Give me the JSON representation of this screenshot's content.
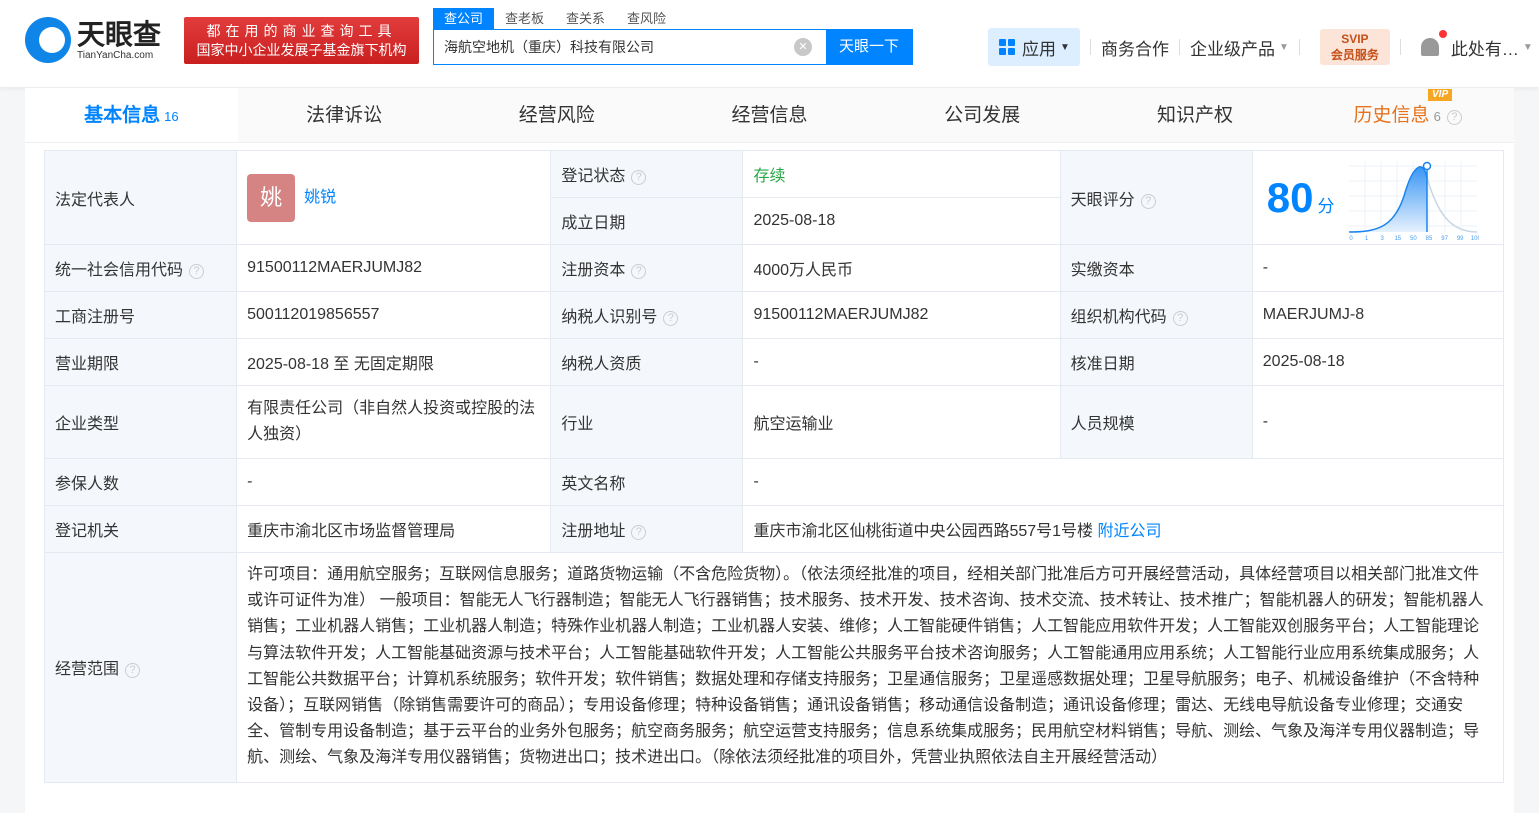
{
  "header": {
    "logo_cn": "天眼查",
    "logo_en": "TianYanCha.com",
    "slogan_line1": "都在用的商业查询工具",
    "slogan_line2": "国家中小企业发展子基金旗下机构",
    "search_tabs": [
      "查公司",
      "查老板",
      "查关系",
      "查风险"
    ],
    "search_value": "海航空地机（重庆）科技有限公司",
    "search_button": "天眼一下",
    "nav": {
      "apps": "应用",
      "business": "商务合作",
      "enterprise": "企业级产品",
      "svip_top": "SVIP",
      "svip_bottom": "会员服务",
      "user": "此处有…"
    }
  },
  "tabs": [
    {
      "label": "基本信息",
      "count": "16"
    },
    {
      "label": "法律诉讼"
    },
    {
      "label": "经营风险"
    },
    {
      "label": "经营信息"
    },
    {
      "label": "公司发展"
    },
    {
      "label": "知识产权"
    },
    {
      "label": "历史信息",
      "count": "6",
      "badge": "VIP"
    }
  ],
  "info": {
    "legal_rep_label": "法定代表人",
    "legal_rep_avatar": "姚",
    "legal_rep": "姚锐",
    "status_label": "登记状态",
    "status": "存续",
    "established_label": "成立日期",
    "established": "2025-08-18",
    "score_label": "天眼评分",
    "score": "80",
    "score_unit": "分",
    "score_axis": [
      "0",
      "1",
      "3",
      "15",
      "50",
      "85",
      "97",
      "99",
      "100"
    ],
    "credit_code_label": "统一社会信用代码",
    "credit_code": "91500112MAERJUMJ82",
    "reg_capital_label": "注册资本",
    "reg_capital": "4000万人民币",
    "paid_capital_label": "实缴资本",
    "paid_capital": "-",
    "reg_no_label": "工商注册号",
    "reg_no": "500112019856557",
    "tax_id_label": "纳税人识别号",
    "tax_id": "91500112MAERJUMJ82",
    "org_code_label": "组织机构代码",
    "org_code": "MAERJUMJ-8",
    "term_label": "营业期限",
    "term": "2025-08-18 至 无固定期限",
    "taxpayer_label": "纳税人资质",
    "taxpayer": "-",
    "approved_label": "核准日期",
    "approved": "2025-08-18",
    "type_label": "企业类型",
    "type": "有限责任公司（非自然人投资或控股的法人独资）",
    "industry_label": "行业",
    "industry": "航空运输业",
    "staff_label": "人员规模",
    "staff": "-",
    "insured_label": "参保人数",
    "insured": "-",
    "english_label": "英文名称",
    "english": "-",
    "authority_label": "登记机关",
    "authority": "重庆市渝北区市场监督管理局",
    "address_label": "注册地址",
    "address": "重庆市渝北区仙桃街道中央公园西路557号1号楼",
    "nearby": "附近公司",
    "scope_label": "经营范围",
    "scope": "许可项目：通用航空服务；互联网信息服务；道路货物运输（不含危险货物）。（依法须经批准的项目，经相关部门批准后方可开展经营活动，具体经营项目以相关部门批准文件或许可证件为准） 一般项目：智能无人飞行器制造；智能无人飞行器销售；技术服务、技术开发、技术咨询、技术交流、技术转让、技术推广；智能机器人的研发；智能机器人销售；工业机器人销售；工业机器人制造；特殊作业机器人制造；工业机器人安装、维修；人工智能硬件销售；人工智能应用软件开发；人工智能双创服务平台；人工智能理论与算法软件开发；人工智能基础资源与技术平台；人工智能基础软件开发；人工智能公共服务平台技术咨询服务；人工智能通用应用系统；人工智能行业应用系统集成服务；人工智能公共数据平台；计算机系统服务；软件开发；软件销售；数据处理和存储支持服务；卫星通信服务；卫星遥感数据处理；卫星导航服务；电子、机械设备维护（不含特种设备）；互联网销售（除销售需要许可的商品）；专用设备修理；特种设备销售；通讯设备销售；移动通信设备制造；通讯设备修理；雷达、无线电导航设备专业修理；交通安全、管制专用设备制造；基于云平台的业务外包服务；航空商务服务；航空运营支持服务；信息系统集成服务；民用航空材料销售；导航、测绘、气象及海洋专用仪器制造；导航、测绘、气象及海洋专用仪器销售；货物进出口；技术进出口。（除依法须经批准的项目外，凭营业执照依法自主开展经营活动）"
  }
}
